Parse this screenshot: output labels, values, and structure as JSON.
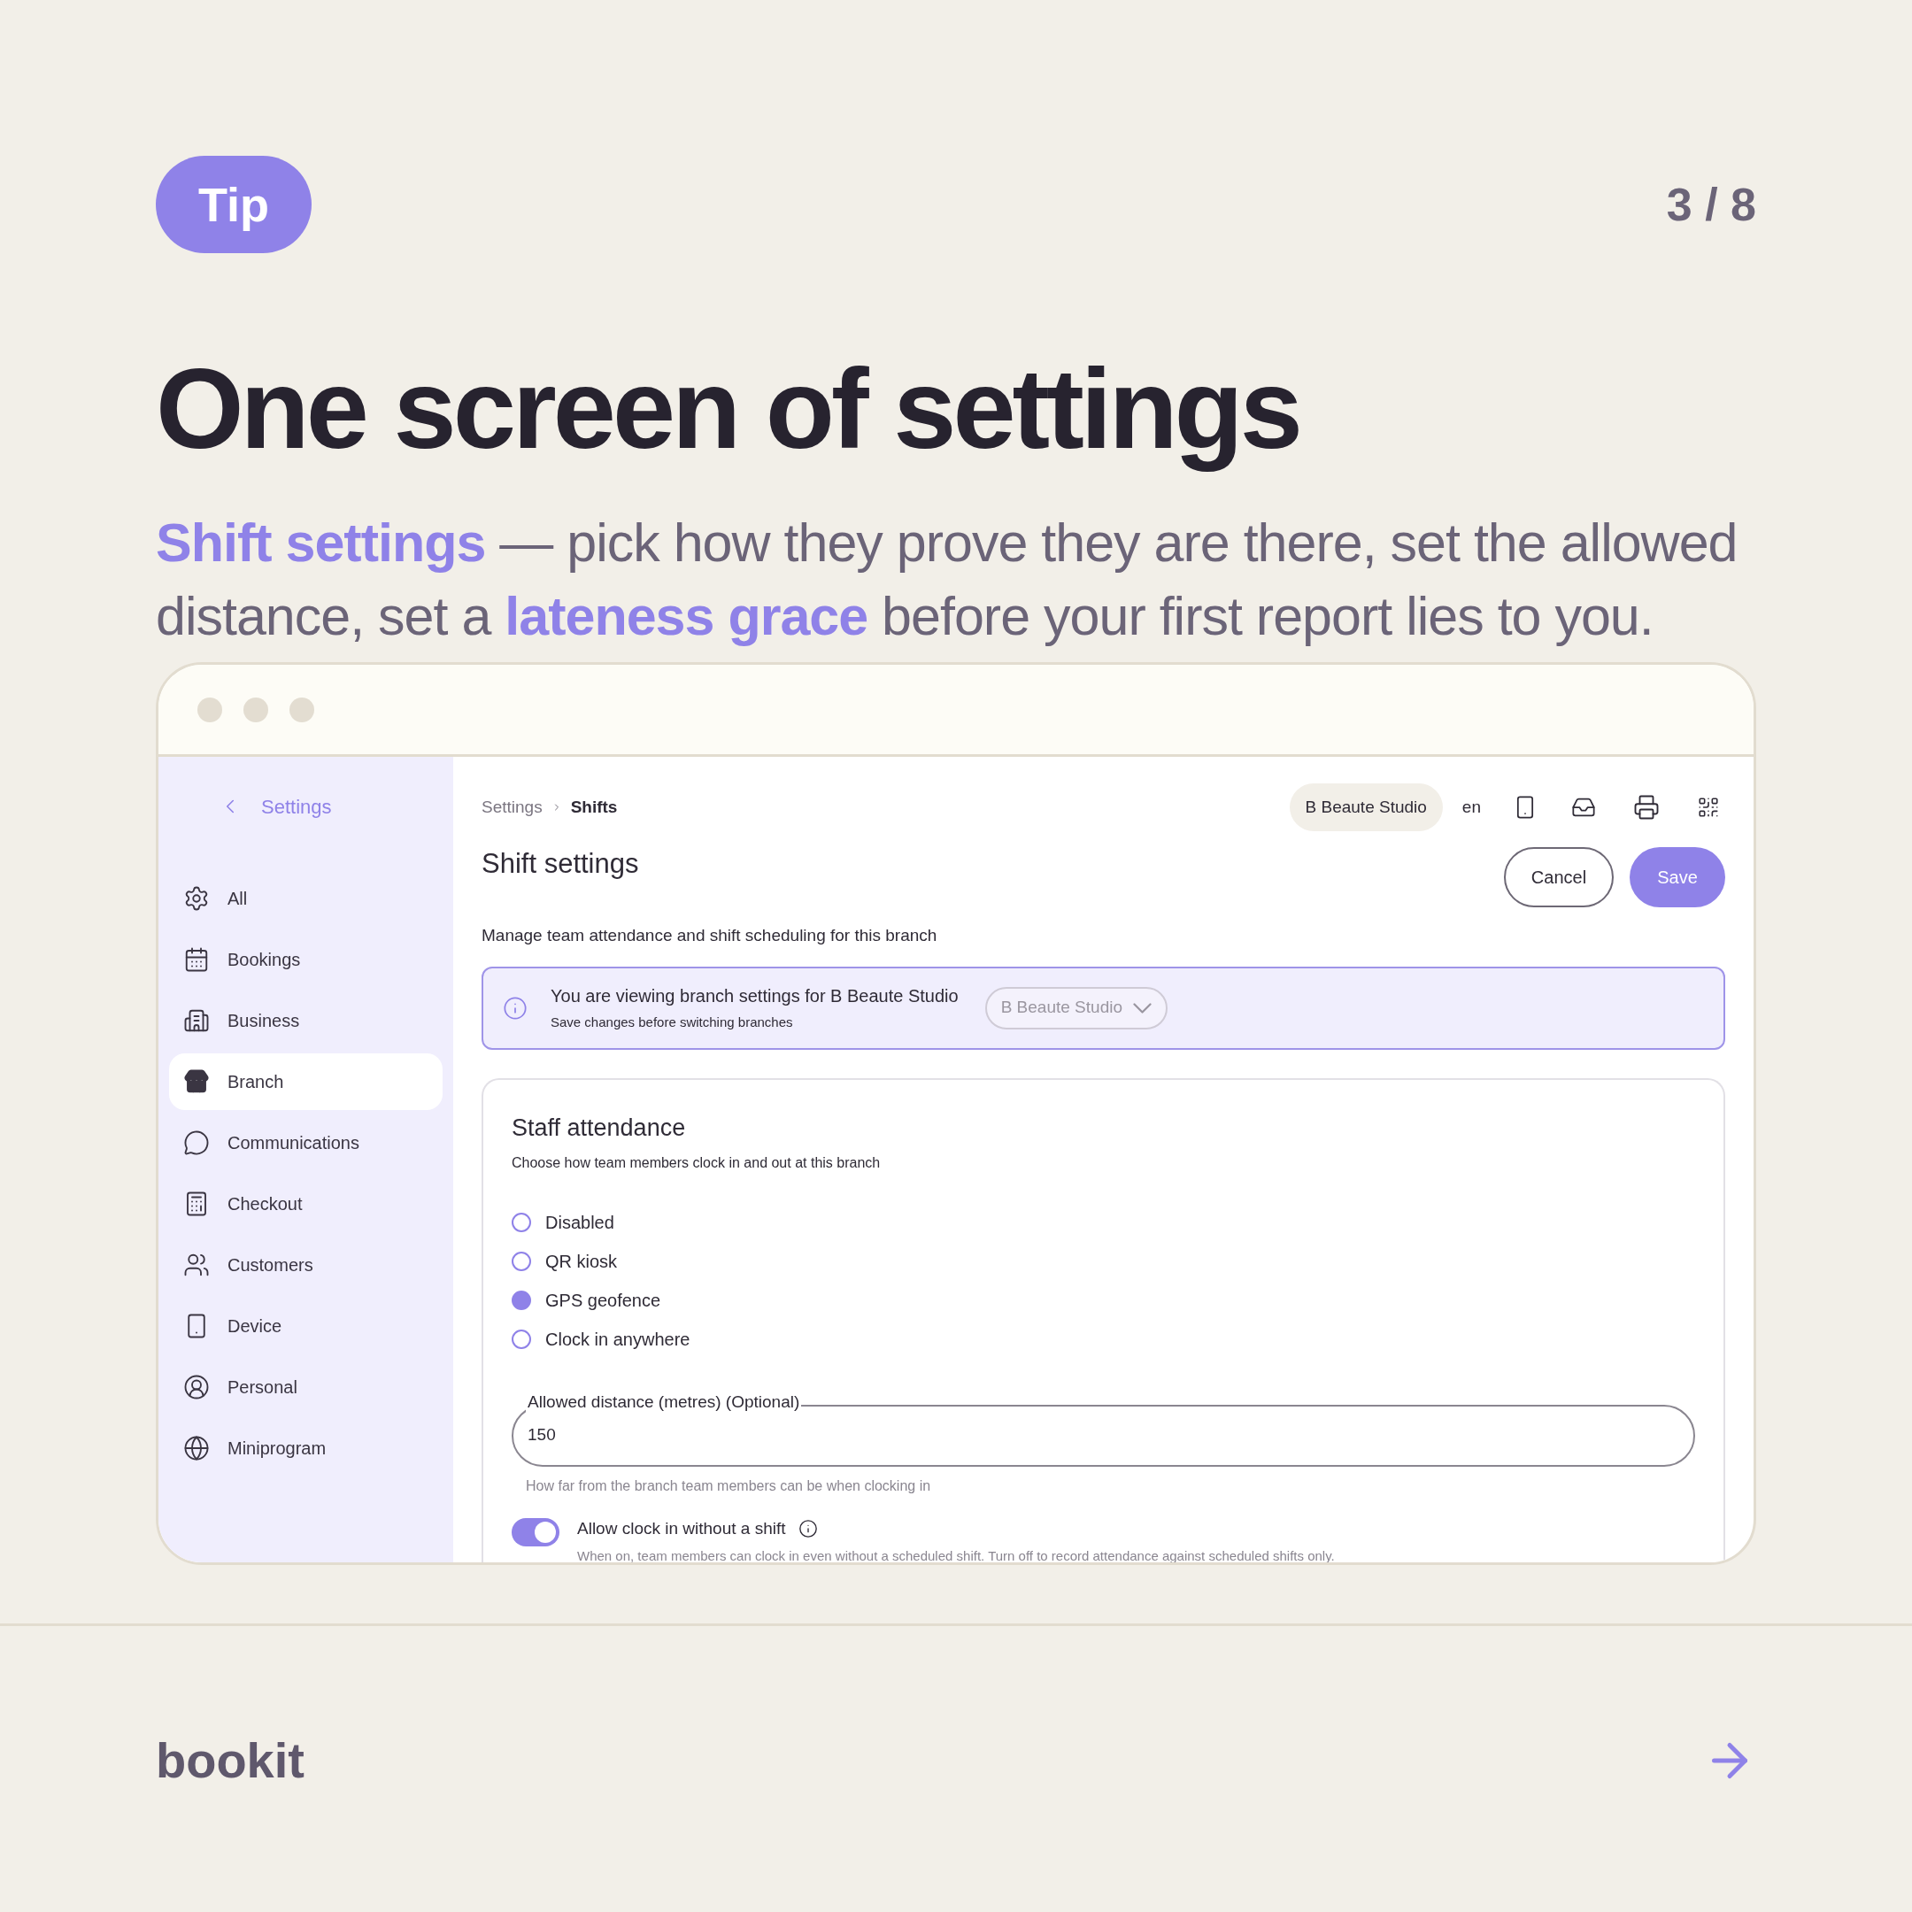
{
  "badge": "Tip",
  "page_counter": "3 / 8",
  "headline": "One screen of settings",
  "subtitle": "**Shift settings** — pick how they prove they are there, set the allowed distance, set a **lateness grace** before your first report lies to you.",
  "app": {
    "sidebar": {
      "back_label": "Settings",
      "items": [
        {
          "label": "All",
          "selected": false
        },
        {
          "label": "Bookings",
          "selected": false
        },
        {
          "label": "Business",
          "selected": false
        },
        {
          "label": "Branch",
          "selected": true
        },
        {
          "label": "Communications",
          "selected": false
        },
        {
          "label": "Checkout",
          "selected": false
        },
        {
          "label": "Customers",
          "selected": false
        },
        {
          "label": "Device",
          "selected": false
        },
        {
          "label": "Personal",
          "selected": false
        },
        {
          "label": "Miniprogram",
          "selected": false
        }
      ]
    },
    "breadcrumb": [
      "Settings",
      "Shifts"
    ],
    "branch_chip": "B Beaute Studio",
    "language": "en",
    "title": "Shift settings",
    "cancel": "Cancel",
    "save": "Save",
    "description": "Manage team attendance and shift scheduling for this branch",
    "banner": {
      "title": "You are viewing branch settings for B Beaute Studio",
      "subtitle": "Save changes before switching branches",
      "select_value": "B Beaute Studio"
    },
    "card": {
      "title": "Staff attendance",
      "subtitle": "Choose how team members clock in and out at this branch",
      "options": [
        {
          "label": "Disabled",
          "selected": false
        },
        {
          "label": "QR kiosk",
          "selected": false
        },
        {
          "label": "GPS geofence",
          "selected": true
        },
        {
          "label": "Clock in anywhere",
          "selected": false
        }
      ],
      "field": {
        "label": "Allowed distance (metres) (Optional)",
        "value": "150",
        "helper": "How far from the branch team members can be when clocking in"
      },
      "toggle": {
        "label": "Allow clock in without a shift",
        "on": true,
        "description": "When on, team members can clock in even without a scheduled shift. Turn off to record attendance against scheduled shifts only."
      }
    }
  },
  "brand": "bookit"
}
